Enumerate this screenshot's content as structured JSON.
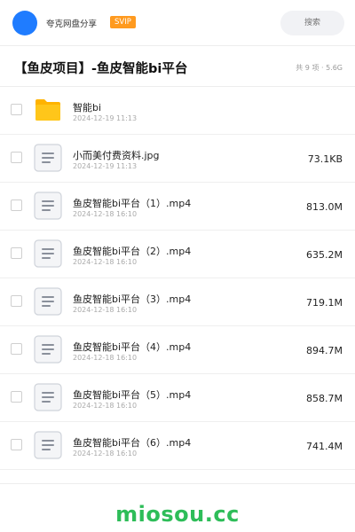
{
  "header": {
    "share_title": "夸克网盘分享",
    "badge": "SVIP",
    "search_placeholder": "搜索",
    "avatar_color": "#1f7cff"
  },
  "folder": {
    "title": "【鱼皮项目】-鱼皮智能bi平台",
    "meta": "共 9 项 · 5.6G"
  },
  "files": [
    {
      "type": "folder",
      "icon": "folder-icon",
      "name": "智能bi",
      "date": "2024-12-19 11:13",
      "size": ""
    },
    {
      "type": "file",
      "icon": "document-icon",
      "name": "小而美付费资料.jpg",
      "date": "2024-12-19 11:13",
      "size": "73.1KB"
    },
    {
      "type": "file",
      "icon": "document-icon",
      "name": "鱼皮智能bi平台（1）.mp4",
      "date": "2024-12-18 16:10",
      "size": "813.0M"
    },
    {
      "type": "file",
      "icon": "document-icon",
      "name": "鱼皮智能bi平台（2）.mp4",
      "date": "2024-12-18 16:10",
      "size": "635.2M"
    },
    {
      "type": "file",
      "icon": "document-icon",
      "name": "鱼皮智能bi平台（3）.mp4",
      "date": "2024-12-18 16:10",
      "size": "719.1M"
    },
    {
      "type": "file",
      "icon": "document-icon",
      "name": "鱼皮智能bi平台（4）.mp4",
      "date": "2024-12-18 16:10",
      "size": "894.7M"
    },
    {
      "type": "file",
      "icon": "document-icon",
      "name": "鱼皮智能bi平台（5）.mp4",
      "date": "2024-12-18 16:10",
      "size": "858.7M"
    },
    {
      "type": "file",
      "icon": "document-icon",
      "name": "鱼皮智能bi平台（6）.mp4",
      "date": "2024-12-18 16:10",
      "size": "741.4M"
    }
  ],
  "footer": {
    "brand": "miosou.cc",
    "brand_color": "#2ebd59"
  }
}
